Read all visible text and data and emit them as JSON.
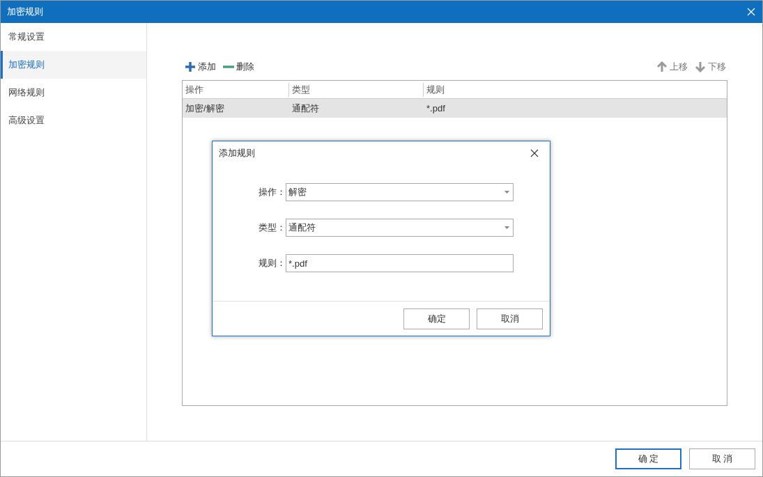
{
  "window": {
    "title": "加密规则"
  },
  "sidebar": {
    "items": [
      {
        "label": "常规设置",
        "selected": false
      },
      {
        "label": "加密规则",
        "selected": true
      },
      {
        "label": "网络规则",
        "selected": false
      },
      {
        "label": "高级设置",
        "selected": false
      }
    ]
  },
  "toolbar": {
    "left": [
      {
        "kind": "add",
        "label": "添加"
      },
      {
        "kind": "remove",
        "label": "删除"
      }
    ],
    "right": [
      {
        "kind": "up",
        "label": "上移"
      },
      {
        "kind": "down",
        "label": "下移"
      }
    ]
  },
  "table": {
    "columns": [
      "操作",
      "类型",
      "规则"
    ],
    "rows": [
      {
        "cells": [
          "加密/解密",
          "通配符",
          "*.pdf"
        ],
        "selected": true
      }
    ]
  },
  "dialog": {
    "title": "添加规则",
    "fields": [
      {
        "kind": "select",
        "label": "操作：",
        "value": "解密"
      },
      {
        "kind": "select",
        "label": "类型：",
        "value": "通配符"
      },
      {
        "kind": "text",
        "label": "规则：",
        "value": "*.pdf"
      }
    ],
    "buttons": [
      {
        "label": "确定",
        "primary": false
      },
      {
        "label": "取消",
        "primary": false
      }
    ]
  },
  "footer": {
    "buttons": [
      {
        "label": "确 定",
        "primary": true
      },
      {
        "label": "取 消",
        "primary": false
      }
    ]
  }
}
